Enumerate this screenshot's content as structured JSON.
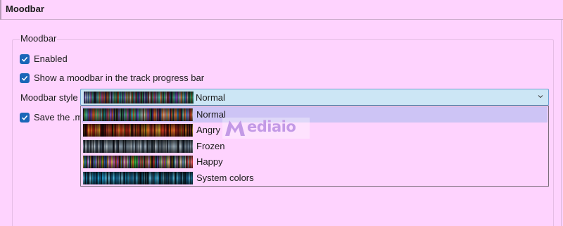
{
  "header": {
    "title": "Moodbar"
  },
  "group": {
    "title": "Moodbar"
  },
  "options": {
    "enabled_label": "Enabled",
    "show_in_progress_label": "Show a moodbar in the track progress bar",
    "save_label_visible": "Save the .mo"
  },
  "style": {
    "label": "Moodbar style",
    "selected": "Normal",
    "choices": [
      "Normal",
      "Angry",
      "Frozen",
      "Happy",
      "System colors"
    ],
    "highlighted": "Normal"
  },
  "watermark": {
    "text": "ediaio"
  },
  "colors": {
    "background": "#fed3fe",
    "checkbox": "#1a66b8",
    "combo_bg": "#cce6f5",
    "highlight": "#cdc4f5"
  },
  "icons": {
    "checkbox": "checkmark-icon",
    "combo": "chevron-down-icon",
    "watermark": "mediaio-logo-icon"
  }
}
